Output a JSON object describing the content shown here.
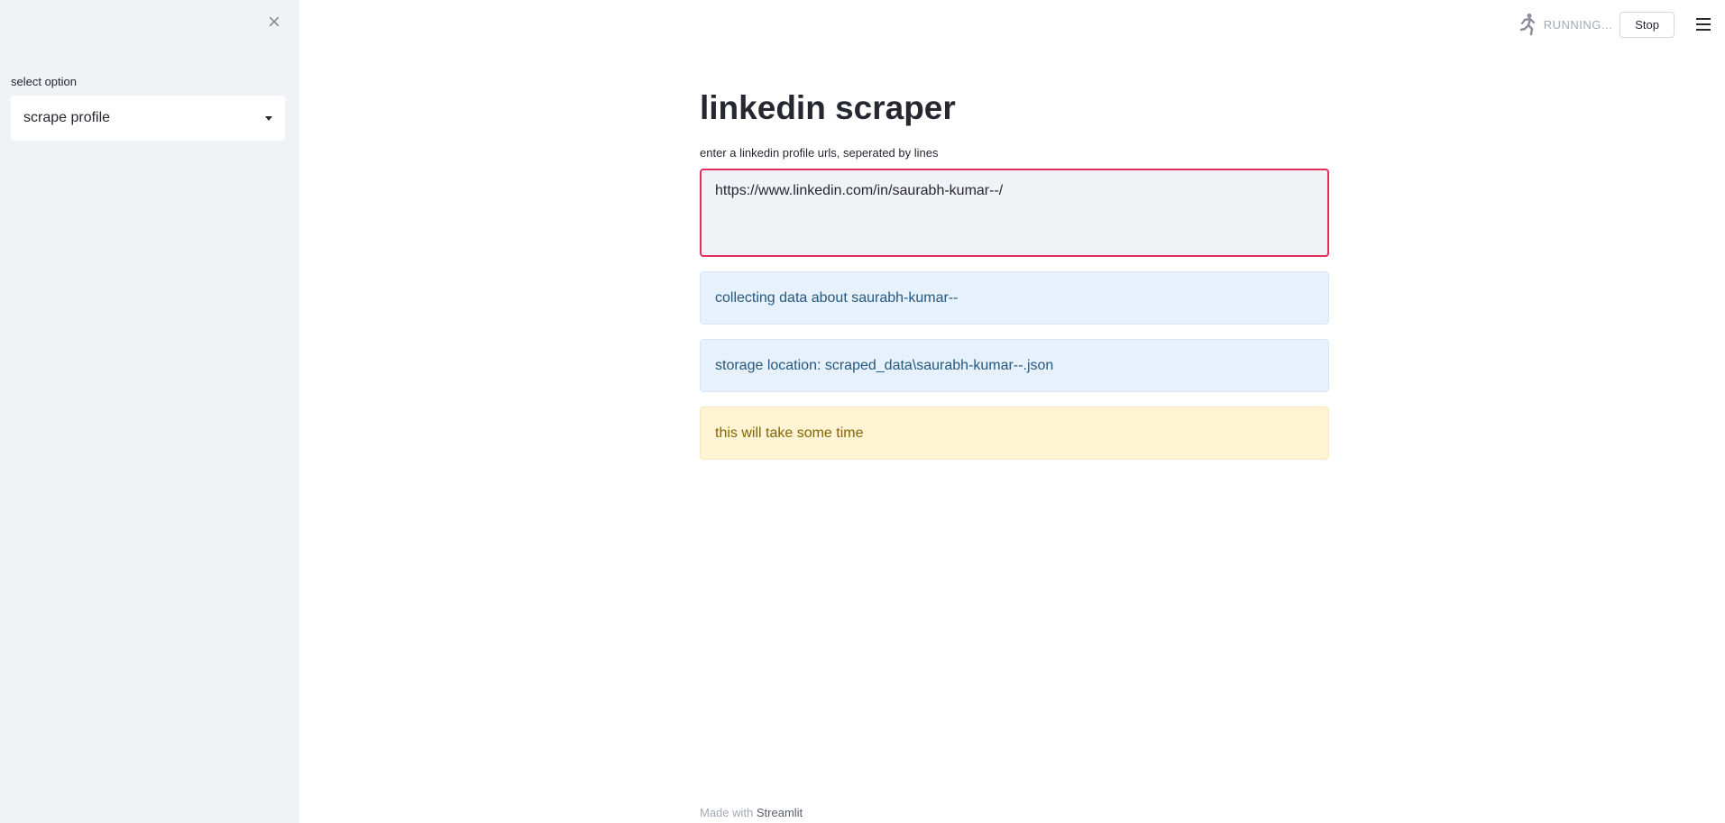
{
  "sidebar": {
    "close_icon": "close-icon",
    "select_label": "select option",
    "select_value": "scrape profile"
  },
  "toolbar": {
    "status_icon": "running-person-icon",
    "status_text": "RUNNING...",
    "stop_label": "Stop",
    "menu_icon": "hamburger-menu-icon"
  },
  "main": {
    "title": "linkedin scraper",
    "input_label": "enter a linkedin profile urls, seperated by lines",
    "input_value": "https://www.linkedin.com/in/saurabh-kumar--/",
    "alerts": [
      {
        "kind": "info",
        "text": "collecting data about saurabh-kumar--"
      },
      {
        "kind": "info",
        "text": "storage location: scraped_data\\saurabh-kumar--.json"
      },
      {
        "kind": "warning",
        "text": "this will take some time"
      }
    ]
  },
  "footer": {
    "prefix": "Made with",
    "link": "Streamlit"
  },
  "colors": {
    "sidebar_bg": "#f0f2f6",
    "input_focus_border": "#e52e5b",
    "info_bg": "#e6f1fb",
    "info_text": "#265880",
    "warning_bg": "#fff4d4",
    "warning_text": "#856404"
  }
}
